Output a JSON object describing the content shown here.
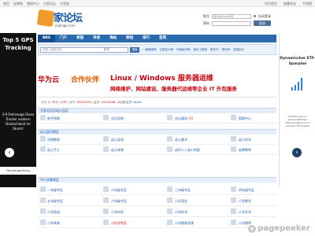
{
  "topbar": {
    "left_links": [
      "首页",
      "宝博网",
      "课程中心",
      "大家论坛",
      "大家园"
    ],
    "right_links": [
      "设为首页",
      "收藏本站",
      "手机版"
    ]
  },
  "logo": {
    "text": "家论坛",
    "domain": "jiaplage.com"
  },
  "login": {
    "account_label": "账号",
    "account_placeholder": "用户名/Email/手机",
    "password_label": "密码",
    "remember_label": "自动登录",
    "login_button": "登录"
  },
  "nav": {
    "items": [
      "BBS",
      "门户",
      "家园",
      "导读",
      "淘帖",
      "群组",
      "排行",
      "签到"
    ]
  },
  "search": {
    "placeholder": "请输入搜索内容",
    "type": "帖子",
    "button": "搜索"
  },
  "hotlinks": [
    "一级建造师",
    "注册会计师",
    "中级经济师",
    "造价工程师",
    "新东方",
    "造价师",
    "初级会计",
    "一级"
  ],
  "banner": {
    "brand": "华为云",
    "brand_tail": "合作伙伴",
    "line1": "Linux / Windows 服务器运维",
    "line2": "网络维护、网站建设、服务器代运维等企业 IT 外包服务"
  },
  "stats": {
    "text1": "今日: ",
    "today": "0",
    "text2": " | 昨日: ",
    "yesterday": "1297",
    "text3": " | 帖子: ",
    "posts": "25514724",
    "text4": " | 会员: ",
    "members": "10013248",
    "text5": " | 欢迎新会员: ",
    "newest": "whjoe"
  },
  "sections": [
    "大家论坛总站公告区",
    "幼儿园早教区",
    "中小学教育区"
  ],
  "rows1": [
    {
      "c1": "新手指南",
      "c2": "论坛导航",
      "c3": "论坛服务",
      "c3n": "(1)",
      "c4": "帮助中心"
    }
  ],
  "rows2": [
    {
      "c1": "早期教育",
      "c2": "幼儿英语",
      "c3": "幼儿美术",
      "c4": "幼儿科学"
    },
    {
      "c1": "幼儿手工",
      "c2": "幼儿体育",
      "c3": "幼升小 | 幼小衔接",
      "c4": "幼教教师"
    }
  ],
  "rows3": [
    {
      "c1": "一年级专区",
      "c2": "二年级专区",
      "c3": "三年级专区",
      "c4": "四年级专区"
    },
    {
      "c1": "五年级专区",
      "c2": "六年级专区",
      "c3": "小学语文",
      "c4": "小学数学"
    },
    {
      "c1": "小学英语",
      "c2": "小学科学",
      "c3": "小学技术",
      "c4": "小学艺术"
    },
    {
      "c1": "小学体育",
      "c2": "小升初专区",
      "c3": "小学教育资源",
      "c4": "小学教师"
    }
  ],
  "left_ad": {
    "headline": "Top 5 GPS Tracking",
    "body": "3-9 Fahrzeuge Diese Tracker erobern Deutschland im Sturm!",
    "footer": "Fahrzeugortung"
  },
  "right_ad": {
    "headline": "Dynamischer ETF-Sparplan",
    "body": "Profitieren Sie von wissenschaftlichem Risikomanagement und optimalen ETF-Auswahl"
  },
  "watermark": {
    "letter": "p",
    "text": "pagepeeker"
  },
  "colors": {
    "nav": "#2b6aad",
    "accent": "#c7000b",
    "link": "#1b5aa8"
  }
}
